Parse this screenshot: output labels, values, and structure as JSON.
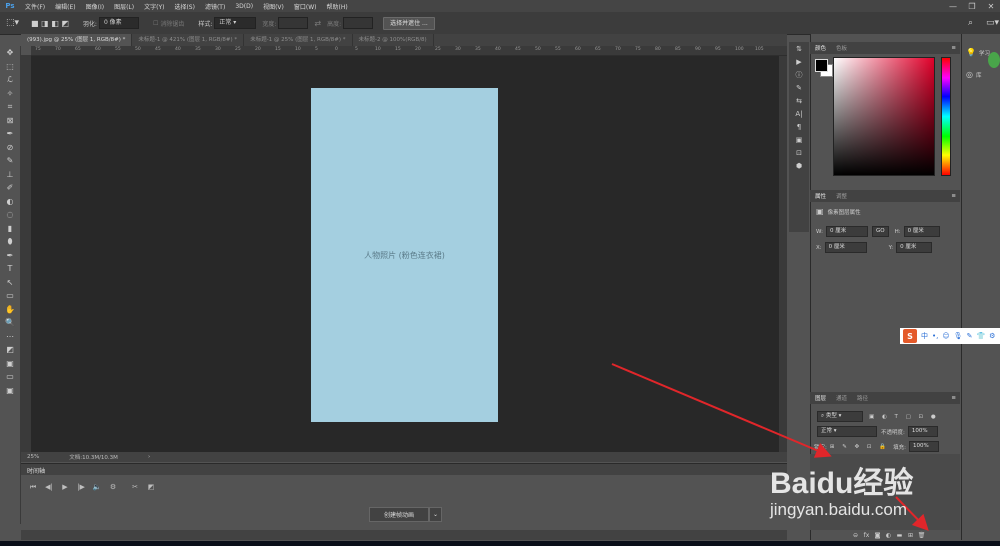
{
  "menubar": {
    "logo": "Ps",
    "items": [
      "文件(F)",
      "编辑(E)",
      "图像(I)",
      "图层(L)",
      "文字(Y)",
      "选择(S)",
      "滤镜(T)",
      "3D(D)",
      "视图(V)",
      "窗口(W)",
      "帮助(H)"
    ],
    "controls": {
      "minimize": "—",
      "restore": "❐",
      "close": "✕"
    }
  },
  "options": {
    "feather_label": "羽化:",
    "feather_value": "0 像素",
    "antialias": "消除锯齿",
    "style_label": "样式:",
    "style_value": "正常",
    "width_label": "宽度:",
    "height_label": "高度:",
    "select_mask_btn": "选择并遮住 ..."
  },
  "tabs": [
    {
      "label": "(993).jpg @ 25% (图层 1, RGB/8#) *",
      "active": true
    },
    {
      "label": "未标题-1 @ 421% (图层 1, RGB/8#) *",
      "active": false
    },
    {
      "label": "未标题-1 @ 25% (图层 1, RGB/8#) *",
      "active": false
    },
    {
      "label": "未标题-2 @ 100%(RGB/8)",
      "active": false
    }
  ],
  "ruler_ticks": [
    "75",
    "70",
    "65",
    "60",
    "55",
    "50",
    "45",
    "40",
    "35",
    "30",
    "25",
    "20",
    "15",
    "10",
    "5",
    "0",
    "5",
    "10",
    "15",
    "20",
    "25",
    "30",
    "35",
    "40",
    "45",
    "50",
    "55",
    "60",
    "65",
    "70",
    "75",
    "80",
    "85",
    "90",
    "95",
    "100",
    "105"
  ],
  "canvas": {
    "photo_label": "人物照片 (粉色连衣裙)"
  },
  "status": {
    "zoom": "25%",
    "doc": "文档:10.3M/10.3M"
  },
  "timeline": {
    "title": "时间轴",
    "create_btn": "创建帧动画"
  },
  "color_panel": {
    "tabs": [
      "颜色",
      "色板"
    ]
  },
  "properties_panel": {
    "tabs": [
      "属性",
      "调整"
    ],
    "layer_type": "像素图层属性",
    "w_label": "W:",
    "w_value": "0 厘米",
    "h_label": "H:",
    "h_value": "0 厘米",
    "x_label": "X:",
    "x_value": "0 厘米",
    "y_label": "Y:",
    "y_value": "0 厘米",
    "link": "GO"
  },
  "layers_panel": {
    "tabs": [
      "图层",
      "通道",
      "路径"
    ],
    "kind": "类型",
    "blend": "正常",
    "opacity_label": "不透明度:",
    "opacity_value": "100%",
    "lock_label": "锁定:",
    "fill_label": "填充:",
    "fill_value": "100%"
  },
  "learn_panel": {
    "learn": "学习",
    "library": "库"
  },
  "sogou": {
    "items": [
      "中",
      "•,",
      "☺",
      "🎙",
      "✎",
      "👕",
      "⚙"
    ]
  },
  "watermark": {
    "brand": "Baidu经验",
    "url": "jingyan.baidu.com"
  },
  "tools": [
    "✥",
    "⬚",
    "ℒ",
    "✧",
    "⌗",
    "⊠",
    "✒",
    "⊘",
    "✎",
    "⊥",
    "✐",
    "◐",
    "◌",
    "▮",
    "⬮",
    "✒",
    "T",
    "↖",
    "▭",
    "✋",
    "🔍",
    "⋯",
    "◩",
    "▣",
    "▭",
    "▣"
  ],
  "panel_icons": [
    "⇅",
    "▶",
    "ⓘ",
    "✎",
    "⇆",
    "A|",
    "¶",
    "▣",
    "⊡",
    "⬢"
  ]
}
